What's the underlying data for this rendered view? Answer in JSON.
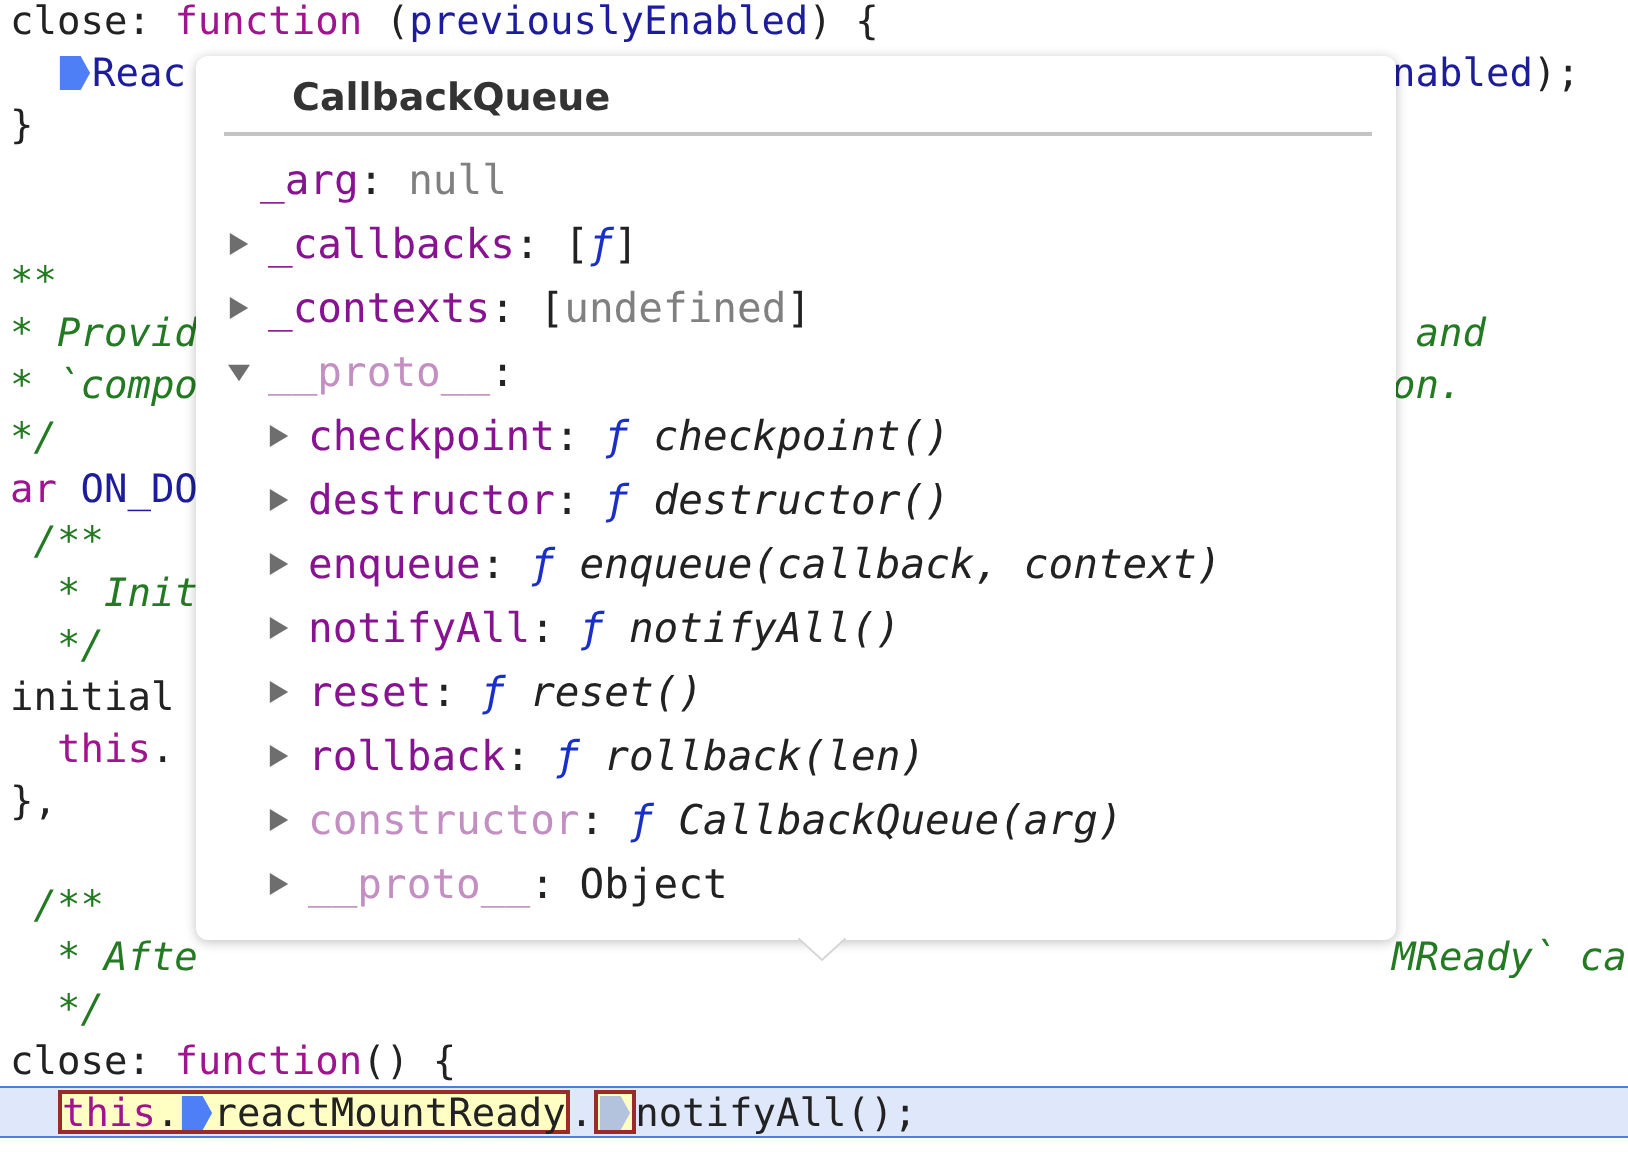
{
  "code_lines": [
    {
      "current": false,
      "left": [
        {
          "kind": "code",
          "tokens": [
            {
              "text": "close: ",
              "kind": "plain"
            },
            {
              "text": "function",
              "kind": "keyword"
            },
            {
              "text": " (",
              "kind": "plain"
            },
            {
              "text": "previouslyEnabled",
              "kind": "ident"
            },
            {
              "text": ") {",
              "kind": "plain"
            }
          ]
        }
      ]
    },
    {
      "current": false,
      "left": [
        {
          "kind": "breakpoint",
          "active": true
        },
        {
          "kind": "code",
          "tokens": [
            {
              "text": "Reac",
              "kind": "ident"
            }
          ]
        }
      ],
      "right": [
        {
          "kind": "code",
          "tokens": [
            {
              "text": "nabled",
              "kind": "ident"
            },
            {
              "text": ");",
              "kind": "plain"
            }
          ]
        }
      ]
    },
    {
      "current": false,
      "left": [
        {
          "kind": "code",
          "tokens": [
            {
              "text": "}",
              "kind": "plain"
            }
          ]
        }
      ]
    },
    {
      "current": false
    },
    {
      "current": false
    },
    {
      "current": false,
      "left": [
        {
          "kind": "code",
          "tokens": [
            {
              "text": "**",
              "kind": "comment"
            }
          ]
        }
      ]
    },
    {
      "current": false,
      "left": [
        {
          "kind": "code",
          "tokens": [
            {
              "text": "* Provid",
              "kind": "comment"
            }
          ]
        }
      ],
      "right": [
        {
          "kind": "code",
          "tokens": [
            {
              "text": " and",
              "kind": "comment"
            }
          ]
        }
      ]
    },
    {
      "current": false,
      "left": [
        {
          "kind": "code",
          "tokens": [
            {
              "text": "* `compo",
              "kind": "comment"
            }
          ]
        }
      ],
      "right": [
        {
          "kind": "code",
          "tokens": [
            {
              "text": "on.",
              "kind": "comment"
            }
          ]
        }
      ]
    },
    {
      "current": false,
      "left": [
        {
          "kind": "code",
          "tokens": [
            {
              "text": "*/",
              "kind": "comment"
            }
          ]
        }
      ]
    },
    {
      "current": false,
      "left": [
        {
          "kind": "code",
          "tokens": [
            {
              "text": "ar",
              "kind": "keyword"
            },
            {
              "text": " ON_DO",
              "kind": "ident"
            }
          ]
        }
      ]
    },
    {
      "current": false,
      "left": [
        {
          "kind": "code",
          "tokens": [
            {
              "text": " /**",
              "kind": "comment"
            }
          ]
        }
      ]
    },
    {
      "current": false,
      "left": [
        {
          "kind": "code",
          "tokens": [
            {
              "text": "  * Init",
              "kind": "comment"
            }
          ]
        }
      ]
    },
    {
      "current": false,
      "left": [
        {
          "kind": "code",
          "tokens": [
            {
              "text": "  */",
              "kind": "comment"
            }
          ]
        }
      ]
    },
    {
      "current": false,
      "left": [
        {
          "kind": "code",
          "tokens": [
            {
              "text": "initial",
              "kind": "plain"
            }
          ]
        }
      ]
    },
    {
      "current": false,
      "left": [
        {
          "kind": "code",
          "tokens": [
            {
              "text": "  this",
              "kind": "keyword"
            },
            {
              "text": ".",
              "kind": "plain"
            }
          ]
        }
      ]
    },
    {
      "current": false,
      "left": [
        {
          "kind": "code",
          "tokens": [
            {
              "text": "},",
              "kind": "plain"
            }
          ]
        }
      ]
    },
    {
      "current": false
    },
    {
      "current": false,
      "left": [
        {
          "kind": "code",
          "tokens": [
            {
              "text": " /**",
              "kind": "comment"
            }
          ]
        }
      ]
    },
    {
      "current": false,
      "left": [
        {
          "kind": "code",
          "tokens": [
            {
              "text": "  * Afte",
              "kind": "comment"
            }
          ]
        }
      ],
      "right": [
        {
          "kind": "code",
          "tokens": [
            {
              "text": "MReady` ca",
              "kind": "comment"
            }
          ]
        }
      ]
    },
    {
      "current": false,
      "left": [
        {
          "kind": "code",
          "tokens": [
            {
              "text": "  */",
              "kind": "comment"
            }
          ]
        }
      ]
    },
    {
      "current": false,
      "left": [
        {
          "kind": "code",
          "tokens": [
            {
              "text": "close: ",
              "kind": "plain"
            },
            {
              "text": "function",
              "kind": "keyword"
            },
            {
              "text": "() {",
              "kind": "plain"
            }
          ]
        }
      ]
    },
    {
      "current": true,
      "left": [
        {
          "kind": "box",
          "segments": [
            {
              "kind": "code",
              "tokens": [
                {
                  "text": "this",
                  "kind": "keyword"
                },
                {
                  "text": ".",
                  "kind": "plain"
                }
              ]
            },
            {
              "kind": "breakpoint",
              "active": true
            },
            {
              "kind": "code",
              "tokens": [
                {
                  "text": "reactMountReady",
                  "kind": "plain"
                }
              ]
            }
          ]
        },
        {
          "kind": "code",
          "tokens": [
            {
              "text": ".",
              "kind": "plain"
            }
          ]
        },
        {
          "kind": "box",
          "segments": [
            {
              "kind": "breakpoint",
              "active": false
            }
          ]
        },
        {
          "kind": "code",
          "tokens": [
            {
              "text": "notifyAll();",
              "kind": "plain"
            }
          ]
        }
      ]
    },
    {
      "current": false
    }
  ],
  "popover": {
    "title": "CallbackQueue",
    "properties": [
      {
        "kind": "leaf",
        "tokens": [
          {
            "text": "_arg",
            "kind": "key"
          },
          {
            "text": ": ",
            "kind": "plain"
          },
          {
            "text": "null",
            "kind": "null"
          }
        ]
      },
      {
        "kind": "node",
        "expanded": false,
        "tokens": [
          {
            "text": "_callbacks",
            "kind": "key"
          },
          {
            "text": ": [",
            "kind": "plain"
          },
          {
            "text": "ƒ",
            "kind": "fn"
          },
          {
            "text": "]",
            "kind": "plain"
          }
        ]
      },
      {
        "kind": "node",
        "expanded": false,
        "tokens": [
          {
            "text": "_contexts",
            "kind": "key"
          },
          {
            "text": ": [",
            "kind": "plain"
          },
          {
            "text": "undefined",
            "kind": "null"
          },
          {
            "text": "]",
            "kind": "plain"
          }
        ]
      },
      {
        "kind": "node",
        "expanded": true,
        "tokens": [
          {
            "text": "__proto__",
            "kind": "dimkey"
          },
          {
            "text": ":",
            "kind": "plain"
          }
        ],
        "children": [
          {
            "kind": "node",
            "expanded": false,
            "tokens": [
              {
                "text": "checkpoint",
                "kind": "key"
              },
              {
                "text": ": ",
                "kind": "plain"
              },
              {
                "text": "ƒ",
                "kind": "fn"
              },
              {
                "text": " checkpoint()",
                "kind": "sig"
              }
            ]
          },
          {
            "kind": "node",
            "expanded": false,
            "tokens": [
              {
                "text": "destructor",
                "kind": "key"
              },
              {
                "text": ": ",
                "kind": "plain"
              },
              {
                "text": "ƒ",
                "kind": "fn"
              },
              {
                "text": " destructor()",
                "kind": "sig"
              }
            ]
          },
          {
            "kind": "node",
            "expanded": false,
            "tokens": [
              {
                "text": "enqueue",
                "kind": "key"
              },
              {
                "text": ": ",
                "kind": "plain"
              },
              {
                "text": "ƒ",
                "kind": "fn"
              },
              {
                "text": " enqueue(callback, context)",
                "kind": "sig"
              }
            ]
          },
          {
            "kind": "node",
            "expanded": false,
            "tokens": [
              {
                "text": "notifyAll",
                "kind": "key"
              },
              {
                "text": ": ",
                "kind": "plain"
              },
              {
                "text": "ƒ",
                "kind": "fn"
              },
              {
                "text": " notifyAll()",
                "kind": "sig"
              }
            ]
          },
          {
            "kind": "node",
            "expanded": false,
            "tokens": [
              {
                "text": "reset",
                "kind": "key"
              },
              {
                "text": ": ",
                "kind": "plain"
              },
              {
                "text": "ƒ",
                "kind": "fn"
              },
              {
                "text": " reset()",
                "kind": "sig"
              }
            ]
          },
          {
            "kind": "node",
            "expanded": false,
            "tokens": [
              {
                "text": "rollback",
                "kind": "key"
              },
              {
                "text": ": ",
                "kind": "plain"
              },
              {
                "text": "ƒ",
                "kind": "fn"
              },
              {
                "text": " rollback(len)",
                "kind": "sig"
              }
            ]
          },
          {
            "kind": "node",
            "expanded": false,
            "tokens": [
              {
                "text": "constructor",
                "kind": "dimkey"
              },
              {
                "text": ": ",
                "kind": "plain"
              },
              {
                "text": "ƒ",
                "kind": "fn"
              },
              {
                "text": " CallbackQueue(arg)",
                "kind": "sig"
              }
            ]
          },
          {
            "kind": "node",
            "expanded": false,
            "tokens": [
              {
                "text": "__proto__",
                "kind": "dimkey"
              },
              {
                "text": ": Object",
                "kind": "plain"
              }
            ]
          }
        ]
      }
    ]
  }
}
